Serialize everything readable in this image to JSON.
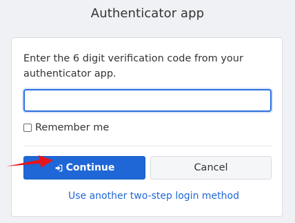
{
  "page": {
    "title": "Authenticator app"
  },
  "form": {
    "instruction": "Enter the 6 digit verification code from your authenticator app.",
    "code_value": "",
    "remember_label": "Remember me",
    "remember_checked": false
  },
  "buttons": {
    "continue_label": "Continue",
    "continue_icon": "sign-in-icon",
    "cancel_label": "Cancel"
  },
  "links": {
    "other_method": "Use another two-step login method"
  },
  "annotation": {
    "arrow_color": "#e8141b"
  },
  "colors": {
    "accent": "#1f67d6",
    "background": "#f0f1f4"
  }
}
